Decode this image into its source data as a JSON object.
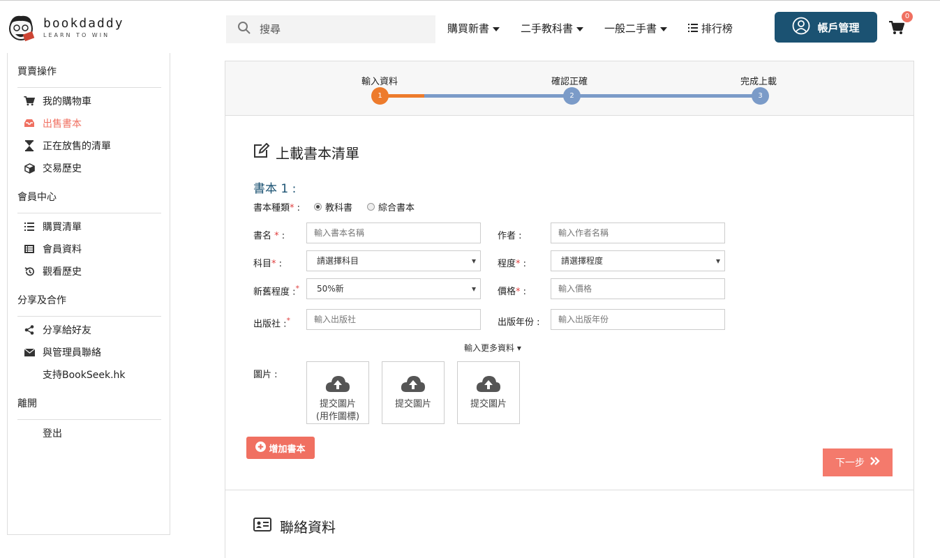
{
  "brand": {
    "name": "bookdaddy",
    "tagline": "LEARN TO WIN"
  },
  "search": {
    "placeholder": "搜尋"
  },
  "nav": {
    "items": [
      {
        "label": "購買新書",
        "icon": "caret-down-icon"
      },
      {
        "label": "二手教科書",
        "icon": "caret-down-icon"
      },
      {
        "label": "一般二手書",
        "icon": "caret-down-icon"
      },
      {
        "label": "排行榜",
        "icon": "list-icon"
      }
    ],
    "account_label": "帳戶管理",
    "cart_count": "0"
  },
  "sidebar": {
    "sections": [
      {
        "title": "買賣操作",
        "items": [
          {
            "label": "我的購物車",
            "icon": "cart-icon"
          },
          {
            "label": "出售書本",
            "icon": "inbox-icon",
            "active": true
          },
          {
            "label": "正在放售的清單",
            "icon": "hourglass-icon"
          },
          {
            "label": "交易歷史",
            "icon": "cube-icon"
          }
        ]
      },
      {
        "title": "會員中心",
        "items": [
          {
            "label": "購買清單",
            "icon": "list-icon"
          },
          {
            "label": "會員資料",
            "icon": "id-list-icon"
          },
          {
            "label": "觀看歷史",
            "icon": "history-icon"
          }
        ]
      },
      {
        "title": "分享及合作",
        "items": [
          {
            "label": "分享給好友",
            "icon": "share-icon"
          },
          {
            "label": "與管理員聯絡",
            "icon": "envelope-icon"
          },
          {
            "label": "支持BookSeek.hk",
            "icon": ""
          }
        ]
      },
      {
        "title": "離開",
        "items": [
          {
            "label": "登出",
            "icon": ""
          }
        ]
      }
    ]
  },
  "steps": [
    {
      "label": "輸入資料",
      "num": "1",
      "color": "#ed7b2c"
    },
    {
      "label": "確認正確",
      "num": "2",
      "color": "#7b9bc8"
    },
    {
      "label": "完成上載",
      "num": "3",
      "color": "#7b9bc8"
    }
  ],
  "form": {
    "title": "上載書本清單",
    "book_title": "書本 1 :",
    "type_label": "書本種類",
    "type_options": [
      "教科書",
      "綜合書本"
    ],
    "type_selected": "教科書",
    "name_label": "書名",
    "name_placeholder": "輸入書本名稱",
    "author_label": "作者 :",
    "author_placeholder": "輸入作者名稱",
    "subject_label": "科目",
    "subject_value": "請選擇科目",
    "level_label": "程度",
    "level_value": "請選擇程度",
    "condition_label": "新舊程度",
    "condition_value": "50%新",
    "price_label": "價格",
    "price_placeholder": "輸入價格",
    "publisher_label": "出版社",
    "publisher_placeholder": "輸入出版社",
    "year_label": "出版年份 :",
    "year_placeholder": "輸入出版年份",
    "more_label": "輸入更多資料",
    "image_label": "圖片 :",
    "uploads": [
      {
        "line1": "提交圖片",
        "line2": "(用作圖標)"
      },
      {
        "line1": "提交圖片",
        "line2": ""
      },
      {
        "line1": "提交圖片",
        "line2": ""
      }
    ],
    "add_book_label": "增加書本",
    "next_label": "下一步"
  },
  "contact": {
    "title": "聯絡資料"
  },
  "colors": {
    "accent": "#f07061",
    "primary": "#1b5272",
    "step_active": "#ed7b2c",
    "step_inactive": "#7b9bc8"
  }
}
